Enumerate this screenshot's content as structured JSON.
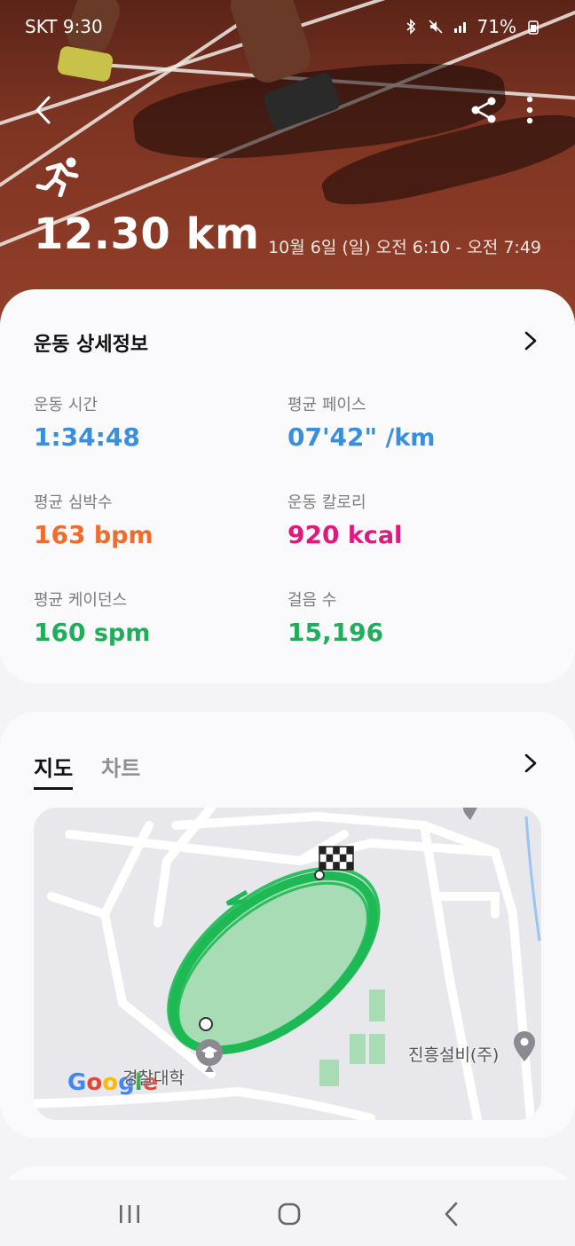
{
  "status_bar": {
    "carrier": "SKT",
    "time": "9:30",
    "battery": "71%"
  },
  "header": {
    "back_icon": "chevron-left-icon",
    "share_icon": "share-icon",
    "more_icon": "more-vertical-icon",
    "activity_icon": "running-icon",
    "distance": "12.30 km",
    "date_range": "10월 6일 (일) 오전 6:10 - 오전 7:49"
  },
  "details": {
    "title": "운동 상세정보",
    "metrics": [
      {
        "label": "운동 시간",
        "value": "1:34:48",
        "unit": "",
        "color": "#3a8fdc"
      },
      {
        "label": "평균 페이스",
        "value": "07'42\"",
        "unit": " /km",
        "color": "#3a8fdc"
      },
      {
        "label": "평균 심박수",
        "value": "163",
        "unit": " bpm",
        "color": "#ef6c2d"
      },
      {
        "label": "운동 칼로리",
        "value": "920",
        "unit": " kcal",
        "color": "#e0197c"
      },
      {
        "label": "평균 케이던스",
        "value": "160",
        "unit": " spm",
        "color": "#1fae5a"
      },
      {
        "label": "걸음 수",
        "value": "15,196",
        "unit": "",
        "color": "#1fae5a"
      }
    ]
  },
  "map_section": {
    "tabs": [
      {
        "label": "지도",
        "active": true
      },
      {
        "label": "차트",
        "active": false
      }
    ],
    "map": {
      "places": {
        "university": "경찰대학",
        "company": "진흥설비(주)"
      },
      "provider": "Google",
      "route_color": "#1db954"
    }
  },
  "nav_bar": {
    "recent_icon": "recent-apps-icon",
    "home_icon": "home-icon",
    "back_icon": "back-icon"
  }
}
